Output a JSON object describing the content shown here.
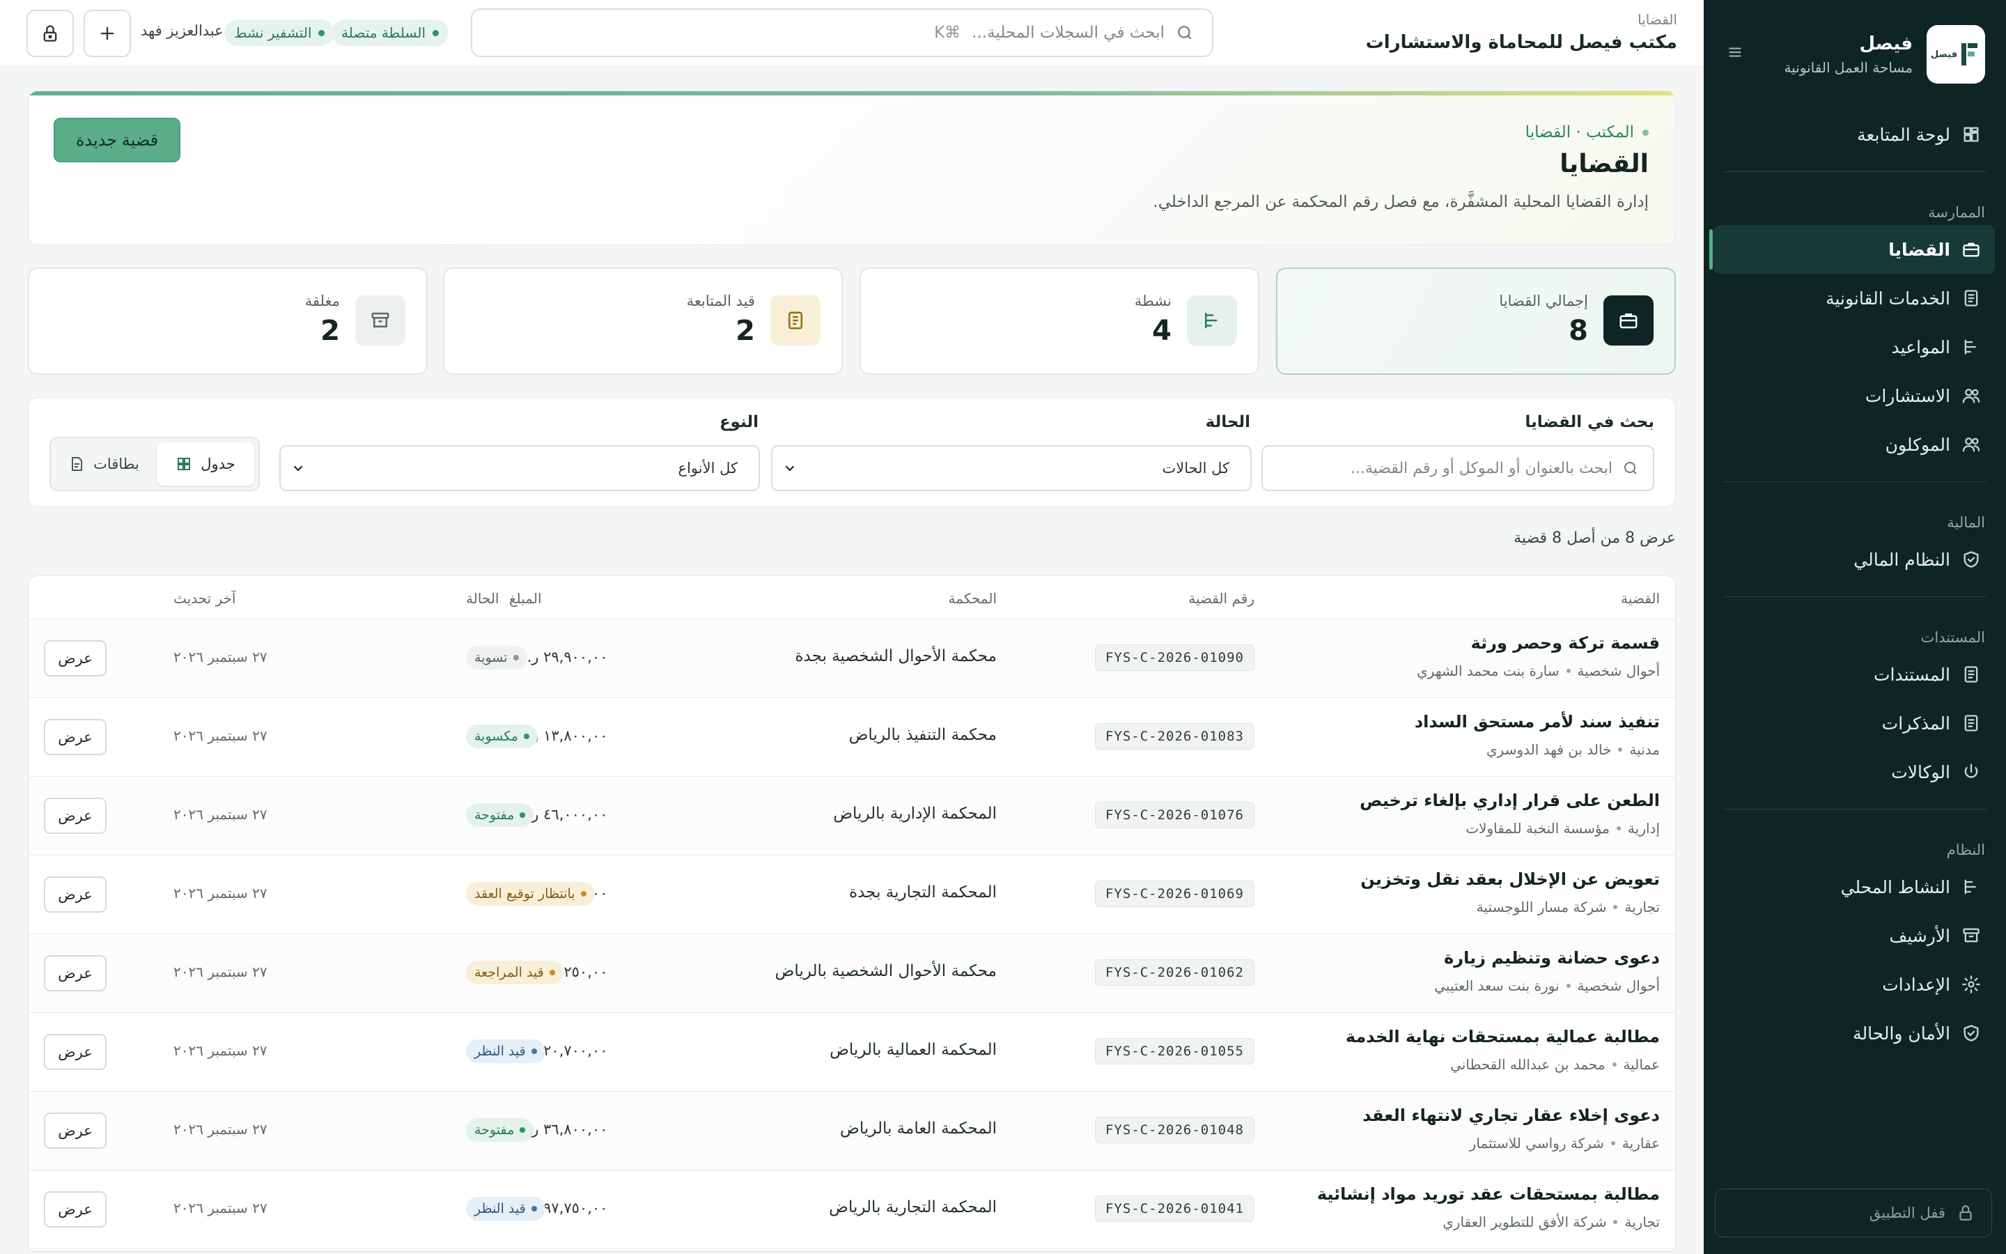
{
  "brand": {
    "name": "فيصل",
    "subtitle": "مساحة العمل القانونية",
    "logo_text": "فيصل"
  },
  "sidebar": {
    "items": [
      {
        "key": "dashboard",
        "label": "لوحة المتابعة",
        "icon": "dashboard-icon"
      },
      {
        "section": "الممارسة"
      },
      {
        "key": "cases",
        "label": "القضايا",
        "icon": "briefcase-icon",
        "active": true
      },
      {
        "key": "services",
        "label": "الخدمات القانونية",
        "icon": "document-icon"
      },
      {
        "key": "appointments",
        "label": "المواعيد",
        "icon": "timeline-icon"
      },
      {
        "key": "consultations",
        "label": "الاستشارات",
        "icon": "users-icon"
      },
      {
        "key": "clients",
        "label": "الموكلون",
        "icon": "users-icon"
      },
      {
        "section": "المالية"
      },
      {
        "key": "finance",
        "label": "النظام المالي",
        "icon": "shield-icon"
      },
      {
        "section": "المستندات"
      },
      {
        "key": "documents",
        "label": "المستندات",
        "icon": "document-icon"
      },
      {
        "key": "memos",
        "label": "المذكرات",
        "icon": "document-icon"
      },
      {
        "key": "poa",
        "label": "الوكالات",
        "icon": "power-icon"
      },
      {
        "section": "النظام"
      },
      {
        "key": "activity",
        "label": "النشاط المحلي",
        "icon": "timeline-icon"
      },
      {
        "key": "archive",
        "label": "الأرشيف",
        "icon": "archive-icon"
      },
      {
        "key": "settings",
        "label": "الإعدادات",
        "icon": "gear-icon"
      },
      {
        "key": "security",
        "label": "الأمان والحالة",
        "icon": "shield-icon"
      }
    ],
    "lock_label": "قفل التطبيق"
  },
  "topbar": {
    "crumb": "القضايا",
    "office": "مكتب فيصل للمحاماة والاستشارات",
    "search_placeholder": "ابحث في السجلات المحلية...",
    "search_shortcut": "⌘K",
    "status_authority": "السلطة متصلة",
    "status_encryption": "التشفير نشط",
    "user": "عبدالعزيز فهد"
  },
  "hero": {
    "crumb": "المكتب · القضايا",
    "title": "القضايا",
    "description": "إدارة القضايا المحلية المشفَّرة، مع فصل رقم المحكمة عن المرجع الداخلي.",
    "new_button": "قضية جديدة"
  },
  "stats": [
    {
      "label": "إجمالي القضايا",
      "value": "8",
      "icon": "briefcase-icon"
    },
    {
      "label": "نشطة",
      "value": "4",
      "icon": "timeline-icon"
    },
    {
      "label": "قيد المتابعة",
      "value": "2",
      "icon": "document-icon"
    },
    {
      "label": "مغلقة",
      "value": "2",
      "icon": "archive-icon"
    }
  ],
  "filters": {
    "search_label": "بحث في القضايا",
    "search_placeholder": "ابحث بالعنوان أو الموكل أو رقم القضية...",
    "status_label": "الحالة",
    "status_value": "كل الحالات",
    "type_label": "النوع",
    "type_value": "كل الأنواع",
    "view_table": "جدول",
    "view_cards": "بطاقات"
  },
  "count_text": "عرض 8 من أصل 8 قضية",
  "table": {
    "headers": {
      "case": "القضية",
      "number": "رقم القضية",
      "court": "المحكمة",
      "amount": "المبلغ",
      "status": "الحالة",
      "updated": "آخر تحديث"
    },
    "view_label": "عرض",
    "rows": [
      {
        "title": "قسمة تركة وحصر ورثة",
        "type": "أحوال شخصية",
        "client": "سارة بنت محمد الشهري",
        "number": "FYS-C-2026-01090",
        "court": "محكمة الأحوال الشخصية بجدة",
        "amount": "٢٩,٩٠٠,٠٠ ر.س",
        "status": "تسوية",
        "tone": "gray",
        "date": "٢٧ سبتمبر ٢٠٢٦"
      },
      {
        "title": "تنفيذ سند لأمر مستحق السداد",
        "type": "مدنية",
        "client": "خالد بن فهد الدوسري",
        "number": "FYS-C-2026-01083",
        "court": "محكمة التنفيذ بالرياض",
        "amount": "١٣,٨٠٠,٠٠ ر.س",
        "status": "مكسوبة",
        "tone": "green",
        "date": "٢٧ سبتمبر ٢٠٢٦"
      },
      {
        "title": "الطعن على قرار إداري بإلغاء ترخيص",
        "type": "إدارية",
        "client": "مؤسسة النخبة للمقاولات",
        "number": "FYS-C-2026-01076",
        "court": "المحكمة الإدارية بالرياض",
        "amount": "٤٦,٠٠٠,٠٠ ر.س",
        "status": "مفتوحة",
        "tone": "green",
        "date": "٢٧ سبتمبر ٢٠٢٦"
      },
      {
        "title": "تعويض عن الإخلال بعقد نقل وتخزين",
        "type": "تجارية",
        "client": "شركة مسار اللوجستية",
        "number": "FYS-C-2026-01069",
        "court": "المحكمة التجارية بجدة",
        "amount": "٦٩,٠٠٠,٠٠ ر.س",
        "status": "بانتظار توقيع العقد",
        "tone": "amber",
        "date": "٢٧ سبتمبر ٢٠٢٦"
      },
      {
        "title": "دعوى حضانة وتنظيم زيارة",
        "type": "أحوال شخصية",
        "client": "نورة بنت سعد العتيبي",
        "number": "FYS-C-2026-01062",
        "court": "محكمة الأحوال الشخصية بالرياض",
        "amount": "١٧,٢٥٠,٠٠ ر.س",
        "status": "قيد المراجعة",
        "tone": "amber",
        "date": "٢٧ سبتمبر ٢٠٢٦"
      },
      {
        "title": "مطالبة عمالية بمستحقات نهاية الخدمة",
        "type": "عمالية",
        "client": "محمد بن عبدالله القحطاني",
        "number": "FYS-C-2026-01055",
        "court": "المحكمة العمالية بالرياض",
        "amount": "٢٠,٧٠٠,٠٠ ر.س",
        "status": "قيد النظر",
        "tone": "blue",
        "date": "٢٧ سبتمبر ٢٠٢٦"
      },
      {
        "title": "دعوى إخلاء عقار تجاري لانتهاء العقد",
        "type": "عقارية",
        "client": "شركة رواسي للاستثمار",
        "number": "FYS-C-2026-01048",
        "court": "المحكمة العامة بالرياض",
        "amount": "٣٦,٨٠٠,٠٠ ر.س",
        "status": "مفتوحة",
        "tone": "green",
        "date": "٢٧ سبتمبر ٢٠٢٦"
      },
      {
        "title": "مطالبة بمستحقات عقد توريد مواد إنشائية",
        "type": "تجارية",
        "client": "شركة الأفق للتطوير العقاري",
        "number": "FYS-C-2026-01041",
        "court": "المحكمة التجارية بالرياض",
        "amount": "٩٧,٧٥٠,٠٠ ر.س",
        "status": "قيد النظر",
        "tone": "blue",
        "date": "٢٧ سبتمبر ٢٠٢٦"
      }
    ]
  },
  "colors": {
    "sidebar": "#0f2523",
    "accent": "#5cae8b",
    "green_text": "#267a58",
    "amber_text": "#8a5a12",
    "blue_text": "#2c5a80",
    "gray_text": "#55615f"
  }
}
